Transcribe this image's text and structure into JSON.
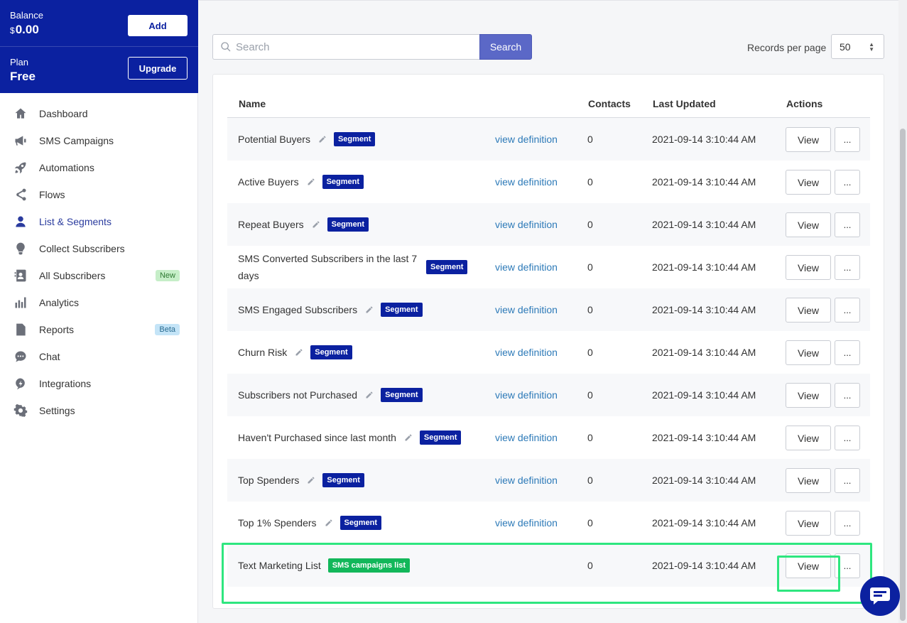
{
  "account": {
    "balance_label": "Balance",
    "balance_currency": "$",
    "balance_value": "0.00",
    "add_label": "Add",
    "plan_label": "Plan",
    "plan_value": "Free",
    "upgrade_label": "Upgrade"
  },
  "sidebar": {
    "items": [
      {
        "label": "Dashboard",
        "icon": "home-icon"
      },
      {
        "label": "SMS Campaigns",
        "icon": "megaphone-icon"
      },
      {
        "label": "Automations",
        "icon": "rocket-icon"
      },
      {
        "label": "Flows",
        "icon": "share-icon"
      },
      {
        "label": "List & Segments",
        "icon": "user-icon",
        "active": true
      },
      {
        "label": "Collect Subscribers",
        "icon": "lightbulb-icon"
      },
      {
        "label": "All Subscribers",
        "icon": "contacts-icon",
        "badge": "New"
      },
      {
        "label": "Analytics",
        "icon": "bar-chart-icon"
      },
      {
        "label": "Reports",
        "icon": "report-icon",
        "badge": "Beta"
      },
      {
        "label": "Chat",
        "icon": "chat-icon"
      },
      {
        "label": "Integrations",
        "icon": "plug-icon"
      },
      {
        "label": "Settings",
        "icon": "gear-icon"
      }
    ]
  },
  "search": {
    "placeholder": "Search",
    "button_label": "Search"
  },
  "records_per_page": {
    "label": "Records per page",
    "value": "50"
  },
  "table": {
    "headers": {
      "name": "Name",
      "contacts": "Contacts",
      "updated": "Last Updated",
      "actions": "Actions"
    },
    "view_definition_label": "view definition",
    "view_label": "View",
    "more_label": "...",
    "rows": [
      {
        "name": "Potential Buyers",
        "tag": "Segment",
        "contacts": "0",
        "updated": "2021-09-14 3:10:44 AM"
      },
      {
        "name": "Active Buyers",
        "tag": "Segment",
        "contacts": "0",
        "updated": "2021-09-14 3:10:44 AM"
      },
      {
        "name": "Repeat Buyers",
        "tag": "Segment",
        "contacts": "0",
        "updated": "2021-09-14 3:10:44 AM"
      },
      {
        "name": "SMS Converted Subscribers in the last 7 days",
        "tag": "Segment",
        "contacts": "0",
        "updated": "2021-09-14 3:10:44 AM"
      },
      {
        "name": "SMS Engaged Subscribers",
        "tag": "Segment",
        "contacts": "0",
        "updated": "2021-09-14 3:10:44 AM"
      },
      {
        "name": "Churn Risk",
        "tag": "Segment",
        "contacts": "0",
        "updated": "2021-09-14 3:10:44 AM"
      },
      {
        "name": "Subscribers not Purchased",
        "tag": "Segment",
        "contacts": "0",
        "updated": "2021-09-14 3:10:44 AM"
      },
      {
        "name": "Haven't Purchased since last month",
        "tag": "Segment",
        "contacts": "0",
        "updated": "2021-09-14 3:10:44 AM"
      },
      {
        "name": "Top Spenders",
        "tag": "Segment",
        "contacts": "0",
        "updated": "2021-09-14 3:10:44 AM"
      },
      {
        "name": "Top 1% Spenders",
        "tag": "Segment",
        "contacts": "0",
        "updated": "2021-09-14 3:10:44 AM"
      },
      {
        "name": "Text Marketing List",
        "tag": "SMS campaigns list",
        "contacts": "0",
        "updated": "2021-09-14 3:10:44 AM"
      }
    ]
  },
  "colors": {
    "brand": "#0b21a0",
    "search_button": "#5b68c7",
    "link": "#2d7ab8",
    "list_tag": "#12b75a",
    "highlight": "#2ee67f"
  }
}
